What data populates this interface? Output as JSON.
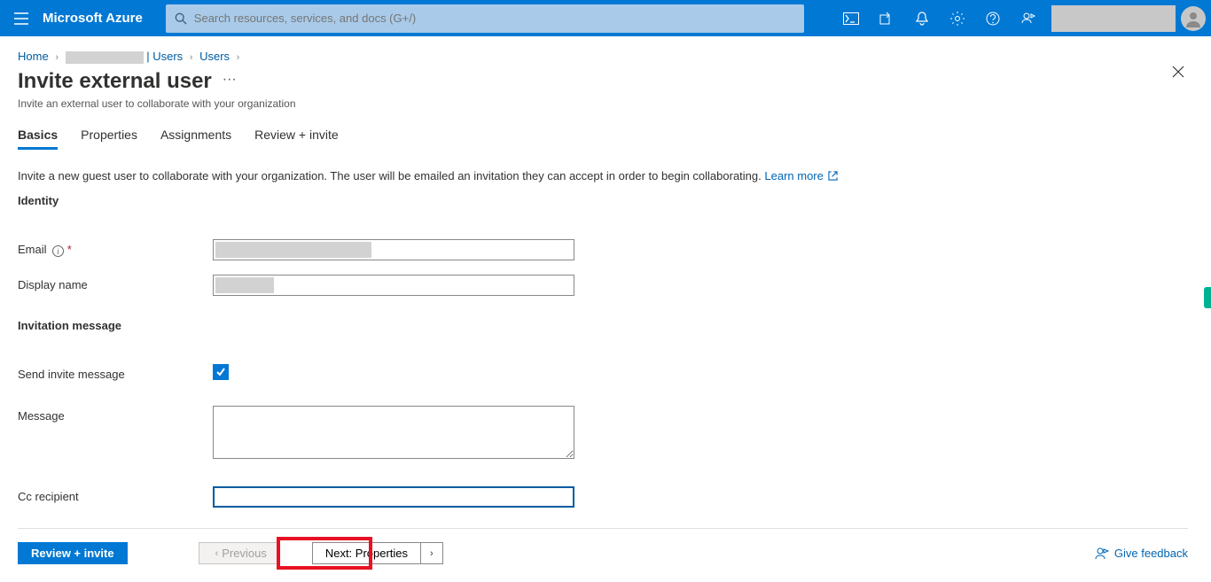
{
  "topbar": {
    "brand": "Microsoft Azure",
    "search_placeholder": "Search resources, services, and docs (G+/)"
  },
  "breadcrumb": {
    "home": "Home",
    "users_link1": "| Users",
    "users_link2": "Users"
  },
  "page": {
    "title": "Invite external user",
    "subtitle": "Invite an external user to collaborate with your organization"
  },
  "tabs": {
    "basics": "Basics",
    "properties": "Properties",
    "assignments": "Assignments",
    "review": "Review + invite"
  },
  "info": {
    "text": "Invite a new guest user to collaborate with your organization. The user will be emailed an invitation they can accept in order to begin collaborating.",
    "learn_more": "Learn more"
  },
  "sections": {
    "identity": "Identity",
    "invitation": "Invitation message"
  },
  "form": {
    "email_label": "Email",
    "email_required": "*",
    "display_name_label": "Display name",
    "send_invite_label": "Send invite message",
    "send_invite_checked": true,
    "message_label": "Message",
    "cc_recipient_label": "Cc recipient"
  },
  "footer": {
    "review_invite": "Review + invite",
    "previous": "Previous",
    "next": "Next: Properties",
    "feedback": "Give feedback"
  }
}
